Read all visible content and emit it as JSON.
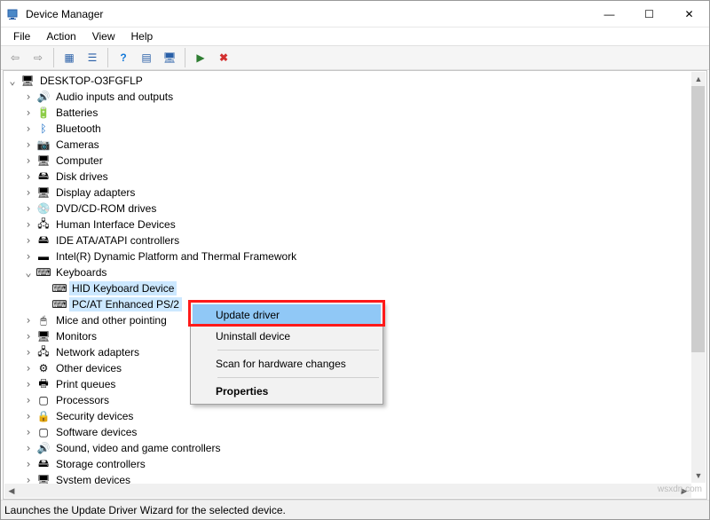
{
  "window": {
    "title": "Device Manager",
    "minimize_glyph": "—",
    "maximize_glyph": "☐",
    "close_glyph": "✕"
  },
  "menubar": [
    "File",
    "Action",
    "View",
    "Help"
  ],
  "toolbar_icons": [
    {
      "name": "back-icon",
      "glyph": "⇦",
      "color": "#888"
    },
    {
      "name": "forward-icon",
      "glyph": "⇨",
      "color": "#888"
    },
    {
      "sep": true
    },
    {
      "name": "views-icon",
      "glyph": "▦",
      "color": "#2a60a8"
    },
    {
      "name": "detail-icon",
      "glyph": "☰",
      "color": "#2a60a8"
    },
    {
      "sep": true
    },
    {
      "name": "help-icon",
      "glyph": "?",
      "color": "#1378d8",
      "bold": true
    },
    {
      "name": "properties-icon",
      "glyph": "▤",
      "color": "#2a60a8"
    },
    {
      "name": "scan-icon",
      "glyph": "🖥",
      "color": "#2a60a8"
    },
    {
      "sep": true
    },
    {
      "name": "enable-icon",
      "glyph": "▶",
      "color": "#2e7d32"
    },
    {
      "name": "disable-icon",
      "glyph": "✖",
      "color": "#d32f2f",
      "bold": true
    }
  ],
  "tree": {
    "root": {
      "label": "DESKTOP-O3FGFLP",
      "icon": "🖥",
      "expanded": true
    },
    "children": [
      {
        "label": "Audio inputs and outputs",
        "icon": "🔊"
      },
      {
        "label": "Batteries",
        "icon": "🔋"
      },
      {
        "label": "Bluetooth",
        "icon": "ᛒ",
        "icon_color": "#0a63c2"
      },
      {
        "label": "Cameras",
        "icon": "📷"
      },
      {
        "label": "Computer",
        "icon": "🖥"
      },
      {
        "label": "Disk drives",
        "icon": "🖴"
      },
      {
        "label": "Display adapters",
        "icon": "🖥"
      },
      {
        "label": "DVD/CD-ROM drives",
        "icon": "💿"
      },
      {
        "label": "Human Interface Devices",
        "icon": "🖧"
      },
      {
        "label": "IDE ATA/ATAPI controllers",
        "icon": "🖴"
      },
      {
        "label": "Intel(R) Dynamic Platform and Thermal Framework",
        "icon": "▬"
      },
      {
        "label": "Keyboards",
        "icon": "⌨",
        "expanded": true,
        "children": [
          {
            "label": "HID Keyboard Device",
            "icon": "⌨",
            "selected": true
          },
          {
            "label": "PC/AT Enhanced PS/2",
            "icon": "⌨",
            "selected": true
          }
        ]
      },
      {
        "label": "Mice and other pointing",
        "icon": "🖱"
      },
      {
        "label": "Monitors",
        "icon": "🖥"
      },
      {
        "label": "Network adapters",
        "icon": "🖧"
      },
      {
        "label": "Other devices",
        "icon": "⚙"
      },
      {
        "label": "Print queues",
        "icon": "🖶"
      },
      {
        "label": "Processors",
        "icon": "▢"
      },
      {
        "label": "Security devices",
        "icon": "🔒"
      },
      {
        "label": "Software devices",
        "icon": "▢"
      },
      {
        "label": "Sound, video and game controllers",
        "icon": "🔊"
      },
      {
        "label": "Storage controllers",
        "icon": "🖴"
      },
      {
        "label": "System devices",
        "icon": "🖥"
      }
    ]
  },
  "context_menu": [
    {
      "label": "Update driver",
      "hover": true
    },
    {
      "label": "Uninstall device"
    },
    {
      "sep": true
    },
    {
      "label": "Scan for hardware changes"
    },
    {
      "sep": true
    },
    {
      "label": "Properties",
      "bold": true
    }
  ],
  "statusbar": "Launches the Update Driver Wizard for the selected device.",
  "watermark": "wsxdn.com"
}
